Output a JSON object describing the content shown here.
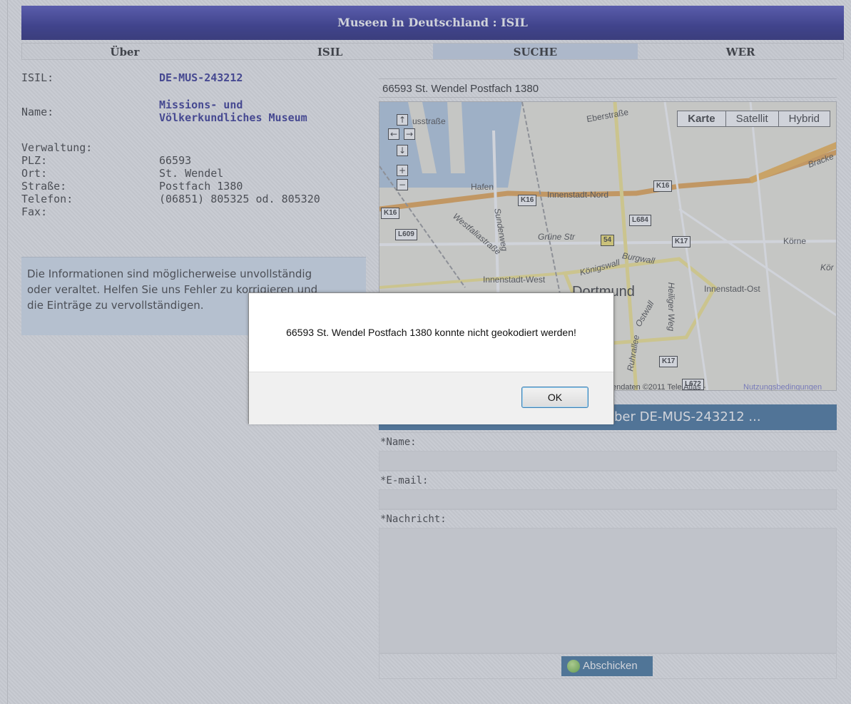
{
  "header": {
    "title": "Museen in Deutschland : ISIL"
  },
  "nav": {
    "items": [
      "Über",
      "ISIL",
      "SUCHE",
      "WER"
    ],
    "active": "SUCHE"
  },
  "record": {
    "isil_label": "ISIL:",
    "isil_value": "DE-MUS-243212",
    "name_label": "Name:",
    "name_line1": "Missions- und",
    "name_line2": "Völkerkundliches Museum",
    "verwaltung_label": "Verwaltung:",
    "plz_label": "PLZ:",
    "plz_value": "66593",
    "ort_label": "Ort:",
    "ort_value": "St. Wendel",
    "strasse_label": "Straße:",
    "strasse_value": "Postfach 1380",
    "telefon_label": "Telefon:",
    "telefon_value": "(06851) 805325 od. 805320",
    "fax_label": "Fax:"
  },
  "note": {
    "line1": "Die Informationen sind möglicherweise unvollständig",
    "line2": "oder veraltet. Helfen Sie uns Fehler zu korrigieren und",
    "line3": "die Einträge zu vervollständigen."
  },
  "map": {
    "address": "66593 St. Wendel Postfach 1380",
    "types": [
      "Karte",
      "Satellit",
      "Hybrid"
    ],
    "selected_type": "Karte",
    "labels": {
      "hafen": "Hafen",
      "innenstadt_nord": "Innenstadt-Nord",
      "innenstadt_west": "Innenstadt-West",
      "innenstadt_ost": "Innenstadt-Ost",
      "dortmund": "Dortmund",
      "korne": "Körne",
      "gruene_str": "Grüne Str",
      "westfalia": "Westfaliastraße",
      "sunderweg": "Sunderweg",
      "koenigswall": "Königswall",
      "burgwall": "Burgwall",
      "eberstrasse": "Eberstraße",
      "heiliger_weg": "Heiliger Weg",
      "ostwall": "Ostwall",
      "ruhrallee": "Ruhrallee",
      "bracke": "Bracke",
      "koer": "Kör",
      "street1": "usstraße"
    },
    "roads": [
      "K16",
      "K16",
      "K16",
      "L684",
      "L609",
      "54",
      "K17",
      "K17",
      "L672"
    ],
    "copyright": "endaten ©2011 Tele Atlas -",
    "terms": "Nutzungsbedingungen"
  },
  "contact": {
    "header": "ber DE-MUS-243212 ...",
    "name_label": "*Name:",
    "email_label": "*E-mail:",
    "message_label": "*Nachricht:",
    "submit_label": "Abschicken"
  },
  "dialog": {
    "message": "66593 St. Wendel Postfach 1380 konnte nicht geokodiert werden!",
    "ok_label": "OK"
  }
}
